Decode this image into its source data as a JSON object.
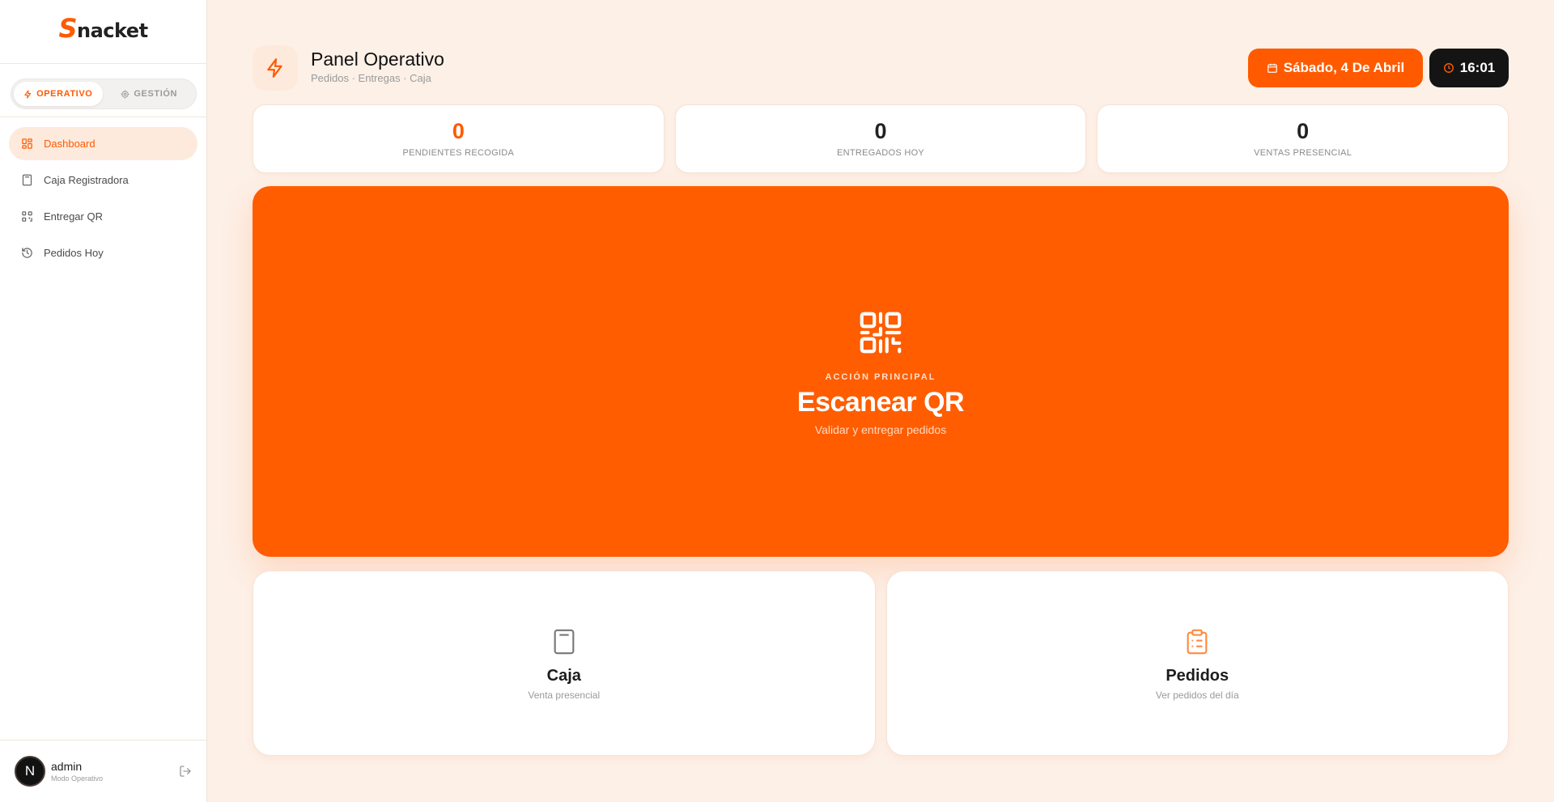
{
  "brand": {
    "logo_first": "S",
    "logo_rest": "nacket",
    "accent": "#ff5a00"
  },
  "mode_switch": {
    "operativo": "OPERATIVO",
    "gestion": "GESTIÓN",
    "active": "operativo"
  },
  "nav": {
    "items": [
      {
        "label": "Dashboard",
        "icon": "grid-icon",
        "active": true
      },
      {
        "label": "Caja Registradora",
        "icon": "calculator-icon",
        "active": false
      },
      {
        "label": "Entregar QR",
        "icon": "qr-icon",
        "active": false
      },
      {
        "label": "Pedidos Hoy",
        "icon": "history-icon",
        "active": false
      }
    ]
  },
  "user": {
    "initial": "N",
    "name": "admin",
    "role": "Modo Operativo"
  },
  "header": {
    "title": "Panel Operativo",
    "subtitle": "Pedidos · Entregas · Caja",
    "date": "Sábado, 4 De Abril",
    "time": "16:01"
  },
  "stats": [
    {
      "value": "0",
      "label": "PENDIENTES RECOGIDA",
      "accent": true
    },
    {
      "value": "0",
      "label": "ENTREGADOS HOY",
      "accent": false
    },
    {
      "value": "0",
      "label": "VENTAS PRESENCIAL",
      "accent": false
    }
  ],
  "hero": {
    "kicker": "ACCIÓN PRINCIPAL",
    "title": "Escanear QR",
    "subtitle": "Validar y entregar pedidos",
    "icon": "qr-code-icon"
  },
  "cards": [
    {
      "title": "Caja",
      "subtitle": "Venta presencial",
      "icon": "calculator-icon"
    },
    {
      "title": "Pedidos",
      "subtitle": "Ver pedidos del día",
      "icon": "clipboard-icon"
    }
  ]
}
